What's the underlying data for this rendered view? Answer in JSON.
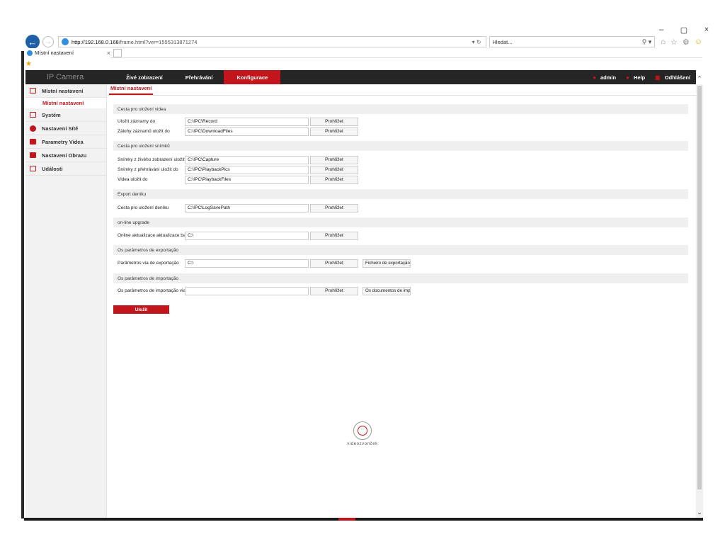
{
  "browser": {
    "address_host": "http://192.168.0.168",
    "address_path": "/frame.html?ver=1555313871274",
    "address_ctrl": "▾ ↻",
    "search_placeholder": "Hledat...",
    "search_icon": "⚲ ▾",
    "tab_title": "Místní nastavení",
    "tab_close": "×",
    "window_controls": [
      "–",
      "▢",
      "×"
    ],
    "icons": [
      "home-icon",
      "star-icon",
      "gear-icon",
      "smiley-icon"
    ]
  },
  "app": {
    "logo": "IP Camera",
    "nav": [
      "Živé zobrazení",
      "Přehrávání",
      "Konfigurace"
    ],
    "active_nav": "Konfigurace",
    "user": "admin",
    "help": "Help",
    "logout": "Odhlášení"
  },
  "sidebar": {
    "items": [
      {
        "label": "Místní nastavení",
        "icon": "monitor-icon"
      },
      {
        "label": "Systém",
        "icon": "system-icon"
      },
      {
        "label": "Nastavení Sítě",
        "icon": "network-icon"
      },
      {
        "label": "Parametry Videa",
        "icon": "video-icon"
      },
      {
        "label": "Nastavení Obrazu",
        "icon": "image-icon"
      },
      {
        "label": "Události",
        "icon": "events-icon"
      }
    ],
    "subitem": "Místní nastavení"
  },
  "main": {
    "sub_tab": "Místní nastavení",
    "sections": [
      "Cesta pro uložení videa",
      "Cesta pro uložení snímků",
      "Export deníku",
      "on-line upgrade",
      "Os parâmetros de exportação",
      "Os parâmetros de importação"
    ],
    "rows": [
      {
        "label": "Uložit záznamy do",
        "value": "C:\\IPC\\Record",
        "button": "Prohlížet"
      },
      {
        "label": "Zálohy záznamů uložit do",
        "value": "C:\\IPC\\DownloadFiles",
        "button": "Prohlížet"
      },
      {
        "label": "Snímky z živého zobrazení uložit do",
        "value": "C:\\IPC\\Capture",
        "button": "Prohlížet"
      },
      {
        "label": "Snímky z přehrávání uložit do",
        "value": "C:\\IPC\\PlaybackPics",
        "button": "Prohlížet"
      },
      {
        "label": "Videa uložit do",
        "value": "C:\\IPC\\PlaybackFiles",
        "button": "Prohlížet"
      },
      {
        "label": "Cesta pro uložení deníku",
        "value": "C:\\IPC\\LogSavePath",
        "button": "Prohlížet"
      },
      {
        "label": "Online aktualizace aktualizace balí...",
        "value": "C:\\",
        "button": "Prohlížet"
      },
      {
        "label": "Parâmetros via de exportação",
        "value": "C:\\",
        "button": "Prohlížet",
        "button2": "Ficheiro de exportação"
      },
      {
        "label": "Os parâmetros de importação via",
        "value": "",
        "button": "Prohlížet",
        "button2": "Os documentos de importação"
      }
    ],
    "save": "Uložit"
  },
  "watermark": "videozvonček"
}
